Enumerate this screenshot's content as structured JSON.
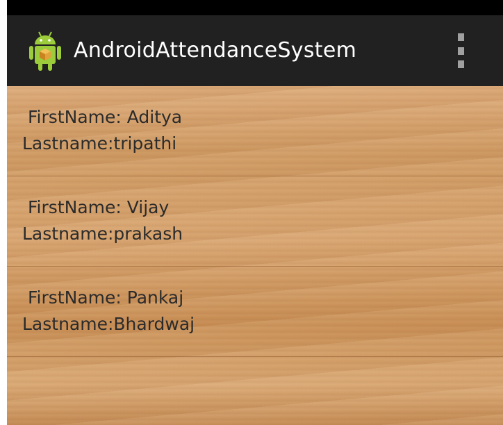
{
  "action_bar": {
    "title": "AndroidAttendanceSystem",
    "icon": "android-robot-icon",
    "overflow_icon": "overflow-menu-icon"
  },
  "students": [
    {
      "first_label": "FirstName: Aditya",
      "last_label": "Lastname:tripathi"
    },
    {
      "first_label": "FirstName: Vijay",
      "last_label": "Lastname:prakash"
    },
    {
      "first_label": "FirstName: Pankaj",
      "last_label": "Lastname:Bhardwaj"
    }
  ],
  "colors": {
    "action_bar_bg": "#212121",
    "status_bar_bg": "#000000",
    "title_text": "#ffffff",
    "list_text": "#2b2b2b",
    "android_green": "#8bc34a"
  }
}
